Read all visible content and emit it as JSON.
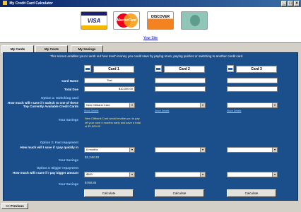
{
  "window": {
    "title": "My Credit Card Calculator"
  },
  "header": {
    "logos": {
      "visa": "VISA",
      "mastercard": "MasterCard",
      "discover": "DISCOVER"
    },
    "your_site_link": "Your Site"
  },
  "tabs": [
    {
      "label": "My Cards"
    },
    {
      "label": "My Costs"
    },
    {
      "label": "My Savings"
    }
  ],
  "intro": "This screen enables you to work out how much money you could save by paying more, paying quicker or switching to another credit card.",
  "cards": [
    {
      "title": "Card 1",
      "name": "Test",
      "total_due": "$10,000.00",
      "switch_select": "New Citibank Card",
      "show_details": "Show Details"
    },
    {
      "title": "Card 2",
      "name": "",
      "total_due": "",
      "switch_select": "",
      "show_details": "Show Details"
    },
    {
      "title": "Card 3",
      "name": "",
      "total_due": "",
      "switch_select": "",
      "show_details": "Show Details"
    }
  ],
  "rows": {
    "card_name": "Card Name",
    "total_due": "Total Due",
    "option1_title": "Option 1: Switching card",
    "option1_question": "How much will I save if I switch to one of these Top Currently Available Credit Cards",
    "your_savings": "Your Savings",
    "switch_note": "New Citibank Card would enable you to pay off your card 4 months early and save a total of $1,500.00",
    "option2_title": "Option 2: Fast repayment",
    "option2_question": "How much will I save if I pay quickly in",
    "option2_select": "6 months",
    "option2_savings": "$1,248.33",
    "option3_title": "Option 3: Bigger repayment",
    "option3_question": "How much will I save if I pay bigger amount",
    "option3_select": "$500",
    "option3_savings": "$789.85"
  },
  "buttons": {
    "calculate": "Calculate",
    "previous": "<< Previous"
  }
}
